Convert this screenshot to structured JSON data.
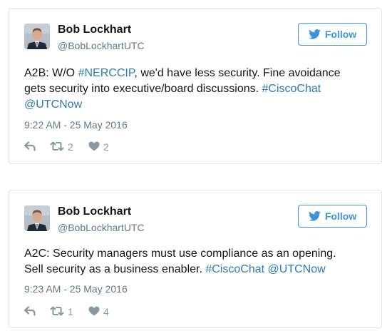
{
  "tweets": [
    {
      "author": {
        "display_name": "Bob Lockhart",
        "screen_name": "@BobLockhartUTC",
        "avatar_icon": "avatar-photo"
      },
      "follow_label": "Follow",
      "text_parts": {
        "line1_a": "A2B: W/O ",
        "line1_link": "#NERCCIP",
        "line1_b": ", we'd have less security. Fine avoidance",
        "line2_a": "gets security into executive/board discussions. ",
        "line2_link": "#CiscoChat",
        "line3_link": "@UTCNow"
      },
      "timestamp": "9:22 AM - 25 May 2016",
      "retweet_count": "2",
      "like_count": "2"
    },
    {
      "author": {
        "display_name": "Bob Lockhart",
        "screen_name": "@BobLockhartUTC",
        "avatar_icon": "avatar-photo"
      },
      "follow_label": "Follow",
      "text_parts": {
        "line1_a": "A2C: Security managers must use compliance as an opening.",
        "line2_a": "Sell security as a business enabler. ",
        "line2_link1": "#CiscoChat",
        "line2_space": " ",
        "line2_link2": "@UTCNow"
      },
      "timestamp": "9:23 AM - 25 May 2016",
      "retweet_count": "1",
      "like_count": "4"
    }
  ],
  "icons": {
    "follow": "twitter-bird-icon",
    "reply": "reply-icon",
    "retweet": "retweet-icon",
    "like": "heart-icon"
  },
  "colors": {
    "brand_blue": "#3b94d9",
    "link_blue": "#2b7bb9",
    "text": "#14171a",
    "muted": "#657786",
    "action_gray": "#8899a6",
    "border": "#e1e8ed"
  }
}
